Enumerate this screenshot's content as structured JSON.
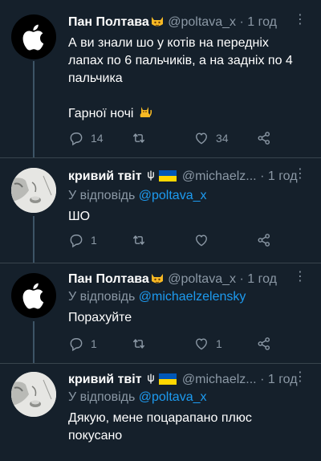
{
  "tweets": [
    {
      "name": "Пан Полтава",
      "handle": "@poltava_x",
      "sep": "·",
      "time": "1 год",
      "more": "⋮",
      "text_lines": [
        "А ви знали шо у котів на передніх",
        "лапах по 6 пальчиків, а на задніх по 4",
        "пальчика"
      ],
      "text2": "Гарної ночі",
      "replies": "14",
      "retweets": "",
      "likes": "34"
    },
    {
      "name": "кривий твіт",
      "handle": "@michaelz...",
      "sep": "·",
      "time": "1 год",
      "more": "⋮",
      "reply_prefix": "У відповідь",
      "reply_to": "@poltava_x",
      "text": "ШО",
      "replies": "1",
      "retweets": "",
      "likes": ""
    },
    {
      "name": "Пан Полтава",
      "handle": "@poltava_x",
      "sep": "·",
      "time": "1 год",
      "more": "⋮",
      "reply_prefix": "У відповідь",
      "reply_to": "@michaelzelensky",
      "text": "Порахуйте",
      "replies": "1",
      "retweets": "",
      "likes": "1"
    },
    {
      "name": "кривий твіт",
      "handle": "@michaelz...",
      "sep": "·",
      "time": "1 год",
      "more": "⋮",
      "reply_prefix": "У відповідь",
      "reply_to": "@poltava_x",
      "text_lines": [
        "Дякую, мене поцарапано плюс",
        "покусано"
      ]
    }
  ],
  "icons": {
    "reply": "reply-icon",
    "retweet": "retweet-icon",
    "like": "heart-icon",
    "share": "share-icon"
  },
  "colors": {
    "background": "#15202b",
    "secondary_text": "#8b98a5",
    "link": "#1d9bf0",
    "divider": "#38444d"
  }
}
